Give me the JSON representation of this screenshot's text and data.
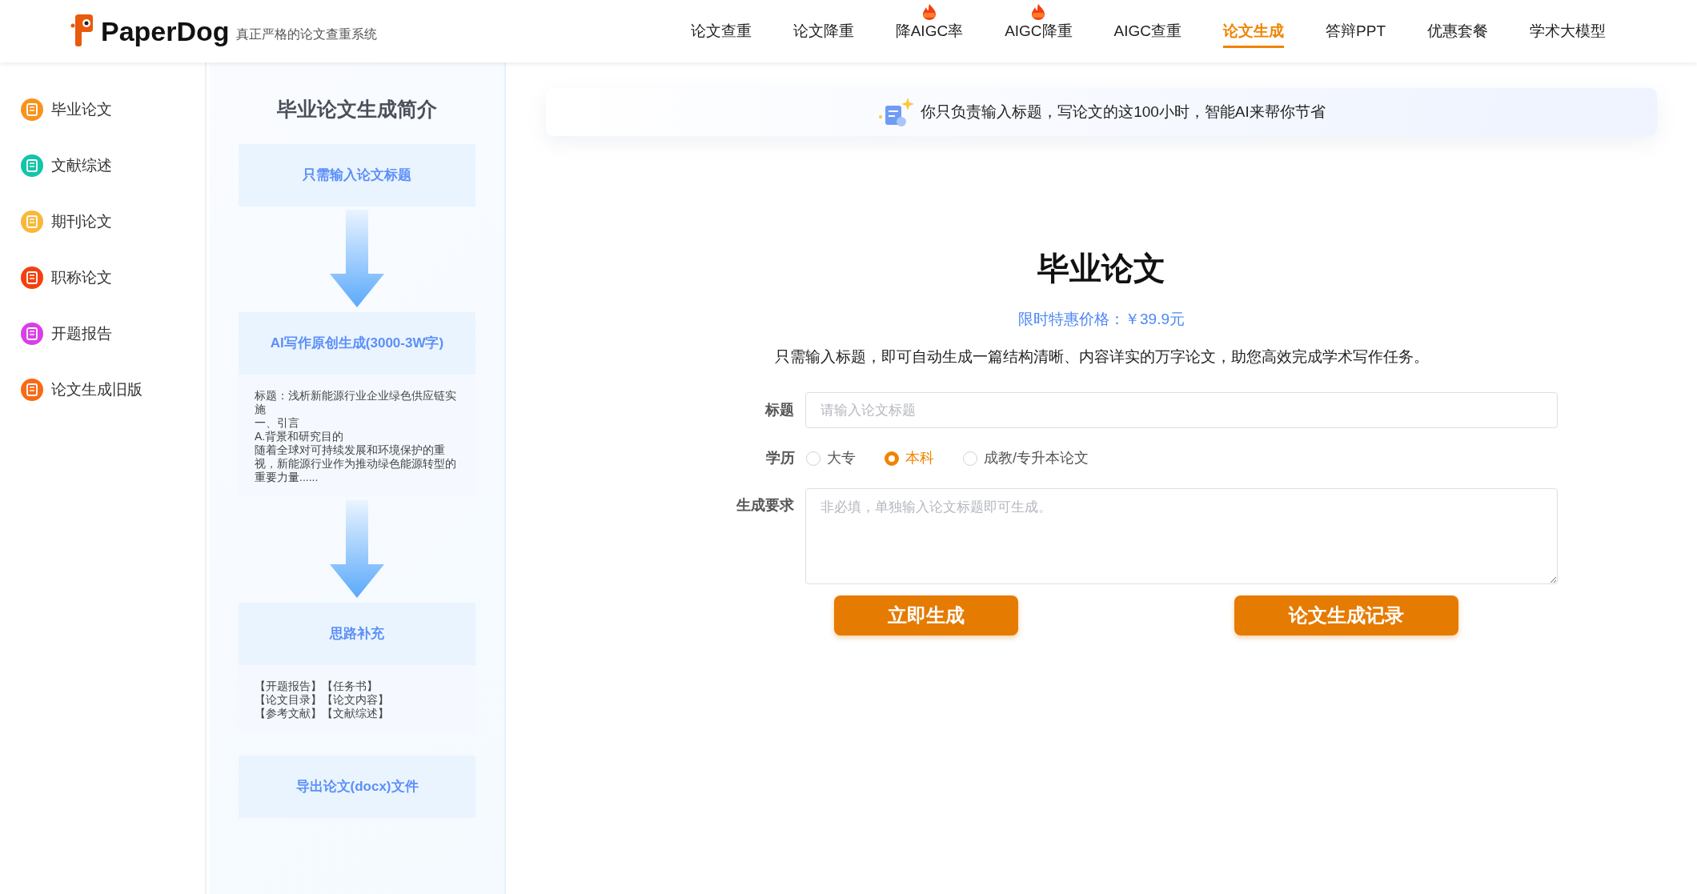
{
  "logo": {
    "name": "PaperDog",
    "tagline": "真正严格的论文查重系统"
  },
  "nav": [
    {
      "label": "论文查重",
      "selected": false,
      "hot": false
    },
    {
      "label": "论文降重",
      "selected": false,
      "hot": false
    },
    {
      "label": "降AIGC率",
      "selected": false,
      "hot": true
    },
    {
      "label": "AIGC降重",
      "selected": false,
      "hot": true
    },
    {
      "label": "AIGC查重",
      "selected": false,
      "hot": false
    },
    {
      "label": "论文生成",
      "selected": true,
      "hot": false
    },
    {
      "label": "答辩PPT",
      "selected": false,
      "hot": false
    },
    {
      "label": "优惠套餐",
      "selected": false,
      "hot": false
    },
    {
      "label": "学术大模型",
      "selected": false,
      "hot": false
    }
  ],
  "sidebar": {
    "items": [
      {
        "label": "毕业论文",
        "color": "#f7931e"
      },
      {
        "label": "文献综述",
        "color": "#14c4a8"
      },
      {
        "label": "期刊论文",
        "color": "#f9b83a"
      },
      {
        "label": "职称论文",
        "color": "#f2400f"
      },
      {
        "label": "开题报告",
        "color": "#d93ee8"
      },
      {
        "label": "论文生成旧版",
        "color": "#f86a16"
      }
    ]
  },
  "intro": {
    "title": "毕业论文生成简介",
    "steps": [
      {
        "kind": "box",
        "label": "只需输入论文标题"
      },
      {
        "kind": "arrow"
      },
      {
        "kind": "box",
        "label": "AI写作原创生成(3000-3W字)",
        "lines": [
          "标题：浅析新能源行业企业绿色供应链实施",
          "一、引言",
          "A.背景和研究目的",
          "随着全球对可持续发展和环境保护的重视，新能源行业作为推动绿色能源转型的重要力量......"
        ]
      },
      {
        "kind": "arrow"
      },
      {
        "kind": "box",
        "label": "思路补充",
        "lines": [
          "【开题报告】【任务书】",
          "【论文目录】【论文内容】",
          "【参考文献】【文献综述】"
        ]
      },
      {
        "kind": "box",
        "label": "导出论文(docx)文件"
      }
    ]
  },
  "banner": {
    "text": "你只负责输入标题，写论文的这100小时，智能AI来帮你节省"
  },
  "main": {
    "title": "毕业论文",
    "price": "限时特惠价格：￥39.9元",
    "description": "只需输入标题，即可自动生成一篇结构清晰、内容详实的万字论文，助您高效完成学术写作任务。"
  },
  "form": {
    "title_field": {
      "label": "标题",
      "placeholder": "请输入论文标题"
    },
    "degree": {
      "label": "学历",
      "options": [
        {
          "label": "大专",
          "selected": false
        },
        {
          "label": "本科",
          "selected": true
        },
        {
          "label": "成教/专升本论文",
          "selected": false
        }
      ]
    },
    "requirements": {
      "label": "生成要求",
      "placeholder": "非必填，单独输入论文标题即可生成。"
    }
  },
  "buttons": [
    "立即生成",
    "论文生成记录"
  ]
}
